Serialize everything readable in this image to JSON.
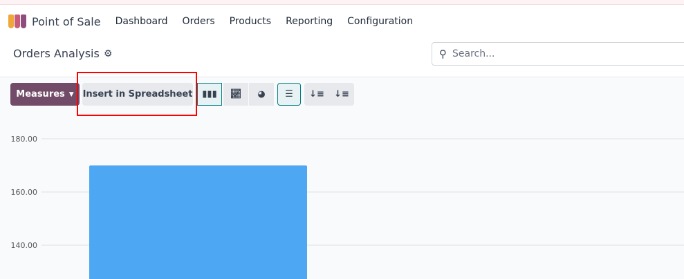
{
  "nav": {
    "app": "Point of Sale",
    "items": [
      "Dashboard",
      "Orders",
      "Products",
      "Reporting",
      "Configuration"
    ]
  },
  "page": {
    "title": "Orders Analysis"
  },
  "search": {
    "placeholder": "Search..."
  },
  "toolbar": {
    "measures": "Measures",
    "insert": "Insert in Spreadsheet",
    "icons": [
      "bar-chart-icon",
      "line-chart-icon",
      "pie-chart-icon",
      "stacked-icon",
      "sort-descending-icon",
      "sort-ascending-icon"
    ]
  },
  "colors": {
    "accent": "#714b67",
    "bar": "#4ea7f2",
    "highlight": "#ff0000"
  },
  "chart_data": {
    "type": "bar",
    "values": [
      170
    ],
    "yticks": [
      "180.00",
      "160.00",
      "140.00"
    ],
    "ylim_visible": [
      140,
      180
    ],
    "grid": true
  }
}
